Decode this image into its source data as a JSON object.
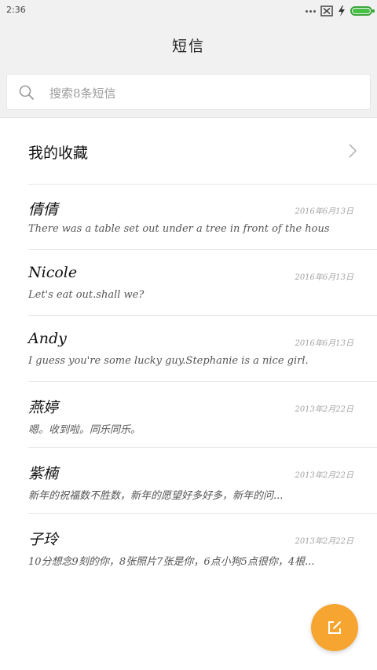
{
  "status_bar": {
    "time": "2:36"
  },
  "header": {
    "title": "短信"
  },
  "search": {
    "placeholder": "搜索8条短信"
  },
  "favorites": {
    "label": "我的收藏"
  },
  "conversations": [
    {
      "name": "倩倩",
      "date": "2016年6月13日",
      "preview": "There was a table set out under a tree in front of the hous"
    },
    {
      "name": "Nicole",
      "date": "2016年6月13日",
      "preview": "Let's eat out.shall we?"
    },
    {
      "name": "Andy",
      "date": "2016年6月13日",
      "preview": "I guess you're some lucky guy.Stephanie is a nice girl."
    },
    {
      "name": "燕婷",
      "date": "2013年2月22日",
      "preview": "嗯。收到啦。同乐同乐。"
    },
    {
      "name": "紫楠",
      "date": "2013年2月22日",
      "preview": "新年的祝福数不胜数，新年的愿望好多好多，新年的问..."
    },
    {
      "name": "子玲",
      "date": "2013年2月22日",
      "preview": "10分想念9刻的你，8张照片7张是你，6点小狗5点很你，4根..."
    }
  ],
  "colors": {
    "fab": "#f5a530",
    "battery": "#46c146",
    "header_bg": "#f1f1f1"
  },
  "icons": {
    "notification": "sim-missing-icon",
    "charging": "lightning-icon",
    "battery": "battery-icon",
    "search": "search-icon",
    "chevron": "chevron-right-icon",
    "compose": "compose-icon"
  }
}
